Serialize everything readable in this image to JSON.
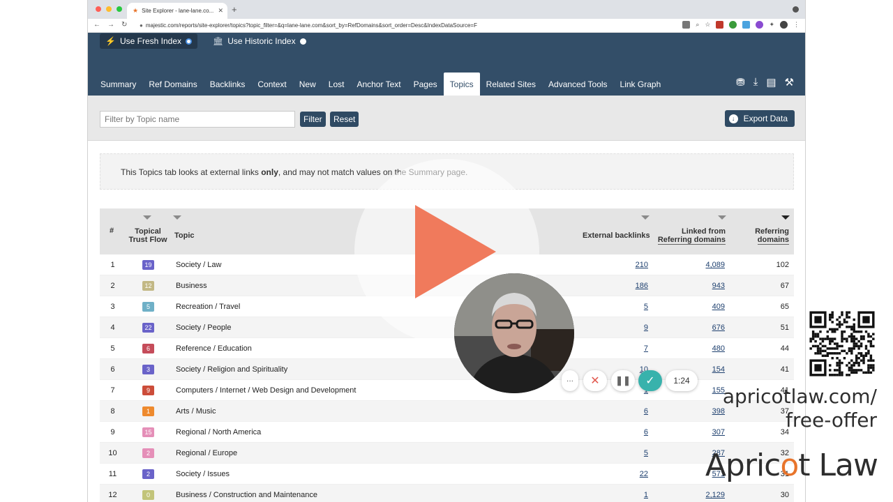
{
  "browser": {
    "tab_title": "Site Explorer - lane-lane.co...",
    "url": "majestic.com/reports/site-explorer/topics?topic_filter=&q=lane-lane.com&sort_by=RefDomains&sort_order=Desc&IndexDataSource=F"
  },
  "index": {
    "fresh_label": "Use Fresh Index",
    "historic_label": "Use Historic Index"
  },
  "nav": {
    "tabs": [
      "Summary",
      "Ref Domains",
      "Backlinks",
      "Context",
      "New",
      "Lost",
      "Anchor Text",
      "Pages",
      "Topics",
      "Related Sites",
      "Advanced Tools",
      "Link Graph"
    ],
    "active_tab": "Topics"
  },
  "filter": {
    "placeholder": "Filter by Topic name",
    "filter_label": "Filter",
    "reset_label": "Reset",
    "export_label": "Export Data"
  },
  "notice": {
    "before": "This Topics tab looks at external links ",
    "bold": "only",
    "after": ", and may not match values on the Summary page."
  },
  "table": {
    "headers": {
      "num": "#",
      "ttf_line1": "Topical",
      "ttf_line2": "Trust Flow",
      "topic": "Topic",
      "external": "External backlinks",
      "linked_line1": "Linked from",
      "linked_line2": "Referring domains",
      "ref_line1": "Referring",
      "ref_line2": "domains"
    },
    "rows": [
      {
        "num": "1",
        "ttf": "19",
        "color": "#6a63c9",
        "topic": "Society / Law",
        "ext": "210",
        "lrd": "4,089",
        "rd": "102"
      },
      {
        "num": "2",
        "ttf": "12",
        "color": "#c2b885",
        "topic": "Business",
        "ext": "186",
        "lrd": "943",
        "rd": "67"
      },
      {
        "num": "3",
        "ttf": "5",
        "color": "#6fb0c7",
        "topic": "Recreation / Travel",
        "ext": "5",
        "lrd": "409",
        "rd": "65"
      },
      {
        "num": "4",
        "ttf": "22",
        "color": "#6a63c9",
        "topic": "Society / People",
        "ext": "9",
        "lrd": "676",
        "rd": "51"
      },
      {
        "num": "5",
        "ttf": "6",
        "color": "#c54c5a",
        "topic": "Reference / Education",
        "ext": "7",
        "lrd": "480",
        "rd": "44"
      },
      {
        "num": "6",
        "ttf": "3",
        "color": "#6a63c9",
        "topic": "Society / Religion and Spirituality",
        "ext": "10",
        "lrd": "154",
        "rd": "41"
      },
      {
        "num": "7",
        "ttf": "9",
        "color": "#cc4d3a",
        "topic": "Computers / Internet / Web Design and Development",
        "ext": "1",
        "lrd": "155",
        "rd": "41"
      },
      {
        "num": "8",
        "ttf": "1",
        "color": "#ee8a2e",
        "topic": "Arts / Music",
        "ext": "6",
        "lrd": "398",
        "rd": "37"
      },
      {
        "num": "9",
        "ttf": "15",
        "color": "#e58fb8",
        "topic": "Regional / North America",
        "ext": "6",
        "lrd": "307",
        "rd": "34"
      },
      {
        "num": "10",
        "ttf": "2",
        "color": "#e58fb8",
        "topic": "Regional / Europe",
        "ext": "5",
        "lrd": "287",
        "rd": "32"
      },
      {
        "num": "11",
        "ttf": "2",
        "color": "#6a63c9",
        "topic": "Society / Issues",
        "ext": "22",
        "lrd": "571",
        "rd": "31"
      },
      {
        "num": "12",
        "ttf": "0",
        "color": "#c2c47a",
        "topic": "Business / Construction and Maintenance",
        "ext": "1",
        "lrd": "2,129",
        "rd": "30"
      }
    ]
  },
  "recorder": {
    "more": "···",
    "time": "1:24"
  },
  "promo": {
    "line1": "apricotlaw.com/",
    "line2": "free-offer",
    "brand_a": "Apric",
    "brand_o": "o",
    "brand_b": "t Law"
  }
}
